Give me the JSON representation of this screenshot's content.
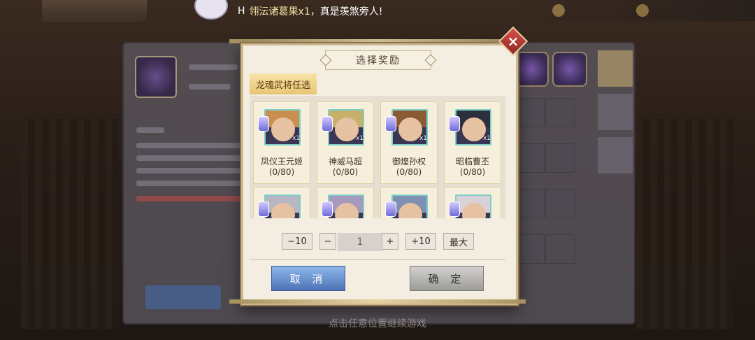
{
  "ticker": {
    "prefix": "H",
    "item": "翎沄诸葛果x1",
    "suffix": "，真是羡煞旁人!"
  },
  "modal": {
    "title": "选择奖励",
    "close_icon": "close-icon",
    "category_tab": "龙魂武将任选",
    "cards": [
      {
        "name": "凤仪王元姬",
        "progress": "(0/80)",
        "qty": "x1",
        "hair": "#c98f4e"
      },
      {
        "name": "神威马超",
        "progress": "(0/80)",
        "qty": "x1",
        "hair": "#c7b06a"
      },
      {
        "name": "御煌孙权",
        "progress": "(0/80)",
        "qty": "x1",
        "hair": "#8a5a34"
      },
      {
        "name": "昭临曹丕",
        "progress": "(0/80)",
        "qty": "x1",
        "hair": "#2d2f3c"
      },
      {
        "name": "",
        "progress": "",
        "qty": "",
        "hair": "#b9b6c4"
      },
      {
        "name": "",
        "progress": "",
        "qty": "",
        "hair": "#a59abb"
      },
      {
        "name": "",
        "progress": "",
        "qty": "",
        "hair": "#7f8fb2"
      },
      {
        "name": "",
        "progress": "",
        "qty": "",
        "hair": "#d8d2d8"
      }
    ],
    "qty_controls": {
      "minus10": "−10",
      "minus": "−",
      "value": "1",
      "plus": "+",
      "plus10": "+10",
      "max": "最大"
    },
    "cancel_label": "取 消",
    "confirm_label": "确 定"
  },
  "hint": "点击任意位置继续游戏",
  "colors": {
    "accent_gold": "#e7c574",
    "cancel_blue": "#4e72b6",
    "close_red": "#d9514a"
  }
}
